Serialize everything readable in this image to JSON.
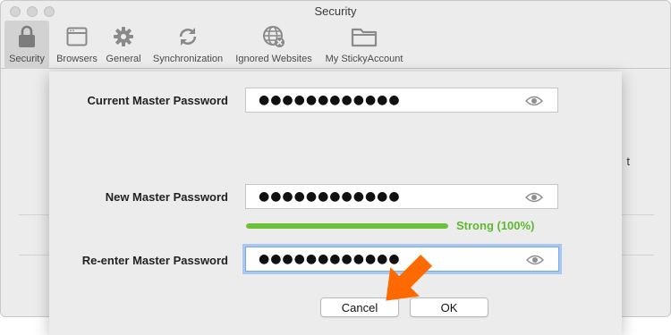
{
  "window": {
    "title": "Security"
  },
  "toolbar": {
    "items": [
      {
        "label": "Security",
        "icon": "lock-icon",
        "active": true
      },
      {
        "label": "Browsers",
        "icon": "browser-window-icon"
      },
      {
        "label": "General",
        "icon": "gear-icon"
      },
      {
        "label": "Synchronization",
        "icon": "sync-icon"
      },
      {
        "label": "Ignored Websites",
        "icon": "globe-blocked-icon"
      },
      {
        "label": "My StickyAccount",
        "icon": "folder-icon"
      }
    ]
  },
  "background": {
    "partial_text": "t"
  },
  "dialog": {
    "current_label": "Current Master Password",
    "current_value": "●●●●●●●●●●●●",
    "new_label": "New Master Password",
    "new_value": "●●●●●●●●●●●●",
    "strength": {
      "percent": 100,
      "label": "Strong (100%)",
      "color": "#6cc13b"
    },
    "reenter_label": "Re-enter Master Password",
    "reenter_value": "●●●●●●●●●●●●",
    "cancel_label": "Cancel",
    "ok_label": "OK"
  },
  "colors": {
    "arrow": "#ff6a00",
    "focus_ring": "#a9c8f1"
  }
}
